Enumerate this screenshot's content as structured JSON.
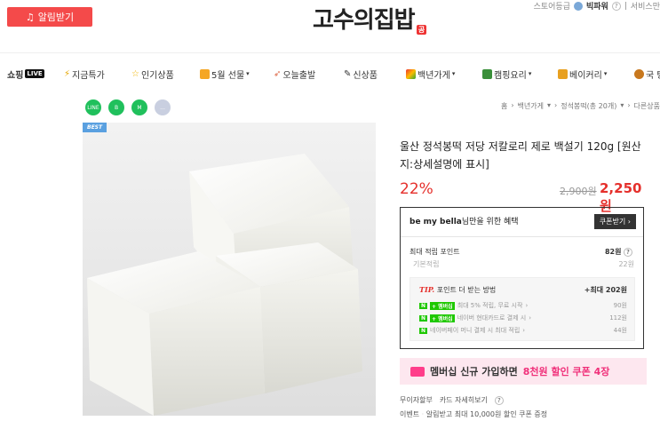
{
  "header": {
    "notify_label": "알림받기",
    "logo_text": "고수의집밥",
    "logo_badge": "공",
    "store_grade": "스토어등급",
    "grade_name": "빅파워",
    "service_label": "서비스만"
  },
  "nav": {
    "shopping_live": "쇼핑",
    "live_badge": "LIVE",
    "items": [
      "지금특가",
      "인기상품",
      "5월 선물",
      "오늘출발",
      "신상품",
      "백년가게",
      "캠핑요리",
      "베이커리",
      "국 탕"
    ]
  },
  "share": [
    "LINE",
    "B",
    "M",
    "..."
  ],
  "breadcrumb": {
    "home": "홈",
    "cat1": "백년가게",
    "cat2": "정석봉떡(총 20개)",
    "cat3": "다른상품"
  },
  "product": {
    "badge": "BEST",
    "title": "울산 정석봉떡 저당 저칼로리 제로 백설기 120g [원산지:상세설명에 표시]",
    "discount": "22%",
    "original_price": "2,900원",
    "final_price": "2,250원"
  },
  "benefit": {
    "header_user": "be my bella",
    "header_suffix": "님만을 위한 혜택",
    "coupon_button": "쿠폰받기",
    "max_point_label": "최대 적립 포인트",
    "max_point_value": "82원",
    "base_label": "기본적립",
    "base_value": "22원",
    "tip_label_prefix": "TIP.",
    "tip_label": "포인트 더 받는 방법",
    "tip_max": "+최대 202원",
    "rows": [
      {
        "text": "최대 5% 적립, 무료 시작",
        "value": "90원"
      },
      {
        "text": "네이버 현대카드로 결제 시",
        "value": "112원"
      },
      {
        "text": "네이버페이 머니 결제 시 최대 적립",
        "value": "44원"
      }
    ]
  },
  "member_banner": {
    "text1": "멤버십 신규 가입하면",
    "highlight": "8천원 할인 쿠폰 4장"
  },
  "bottom": {
    "installment": "무이자할부",
    "card_detail": "카드 자세히보기",
    "event_label": "이벤트",
    "event_text": "알림받고 최대 10,000원 할인 쿠폰 증정"
  }
}
